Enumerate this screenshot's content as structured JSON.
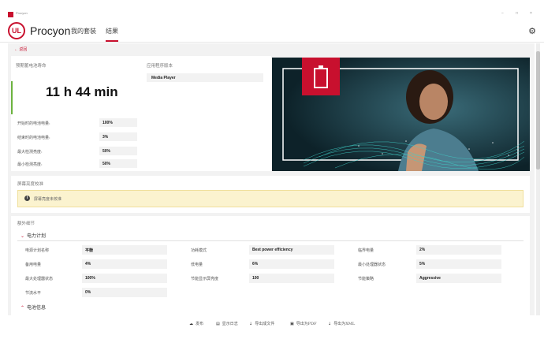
{
  "window": {
    "title": "Procyon",
    "controls": [
      "−",
      "□",
      "×"
    ]
  },
  "header": {
    "brand": "Procyon",
    "logo_text": "UL",
    "tabs": [
      {
        "label": "我的套装"
      },
      {
        "label": "结果"
      }
    ],
    "settings_icon": "gear-icon"
  },
  "back_label": "← 返回",
  "battery": {
    "title": "预期蓄电池寿命",
    "time": "11 h 44 min",
    "rows": [
      {
        "label": "开始时的电池电量:",
        "value": "100%"
      },
      {
        "label": "结束时的电池电量:",
        "value": "3%"
      },
      {
        "label": "最大检测亮度:",
        "value": "50%"
      },
      {
        "label": "最小检测亮度:",
        "value": "50%"
      }
    ]
  },
  "version": {
    "title": "应用程序版本",
    "value": "Media Player"
  },
  "brightness": {
    "title": "屏幕亮度校准",
    "warning": "屏幕亮度未校准"
  },
  "details": {
    "title": "额外细节",
    "power_plan": {
      "heading": "电力计划",
      "rows": [
        [
          {
            "label": "电源计划名称",
            "value": "平衡"
          },
          {
            "label": "功耗模式",
            "value": "Best power efficiency"
          },
          {
            "label": "临界电量",
            "value": "2%"
          }
        ],
        [
          {
            "label": "备用电量",
            "value": "4%"
          },
          {
            "label": "低电量",
            "value": "6%"
          },
          {
            "label": "最小处理器状态",
            "value": "5%"
          }
        ],
        [
          {
            "label": "最大处理器状态",
            "value": "100%"
          },
          {
            "label": "节能显示屏亮度",
            "value": "100"
          },
          {
            "label": "节能策略",
            "value": "Aggressive"
          }
        ],
        [
          {
            "label": "节流水平",
            "value": "0%"
          }
        ]
      ]
    },
    "battery_info": {
      "heading": "电池信息"
    }
  },
  "footer": {
    "items": [
      {
        "icon": "cloud-icon",
        "label": "发布"
      },
      {
        "icon": "document-icon",
        "label": "显示日志"
      },
      {
        "icon": "download-icon",
        "label": "导出成文件"
      },
      {
        "icon": "save-icon",
        "label": "导出为PDF"
      },
      {
        "icon": "download-icon",
        "label": "导出为XML"
      }
    ]
  },
  "colors": {
    "accent": "#c8102e",
    "green": "#6cb33f",
    "warning_bg": "#fbf3cf"
  }
}
